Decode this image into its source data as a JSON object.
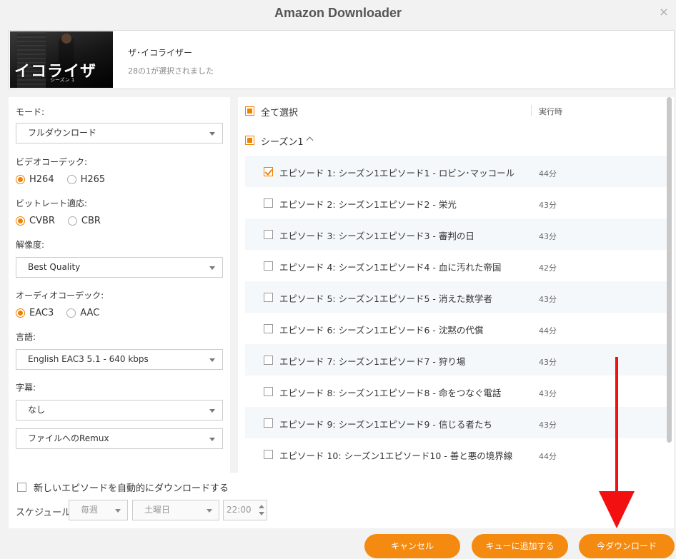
{
  "window": {
    "title": "Amazon Downloader",
    "close_glyph": "×"
  },
  "header": {
    "thumbnail_text": "イコライザ",
    "thumbnail_subtext": "シーズン 1",
    "show_name": "ザ･イコライザー",
    "selection_status": "28の1が選択されました"
  },
  "settings": {
    "mode_label": "モード:",
    "mode_value": "フルダウンロード",
    "video_codec_label": "ビデオコーデック:",
    "video_codec_options": [
      "H264",
      "H265"
    ],
    "video_codec_selected": "H264",
    "bitrate_label": "ビットレート適応:",
    "bitrate_options": [
      "CVBR",
      "CBR"
    ],
    "bitrate_selected": "CVBR",
    "resolution_label": "解像度:",
    "resolution_value": "Best Quality",
    "audio_codec_label": "オーディオコーデック:",
    "audio_codec_options": [
      "EAC3",
      "AAC"
    ],
    "audio_codec_selected": "EAC3",
    "language_label": "言語:",
    "language_value": "English EAC3 5.1 - 640 kbps",
    "subtitle_label": "字幕:",
    "subtitle_value": "なし",
    "remux_value": "ファイルへのRemux"
  },
  "episode_list": {
    "select_all_label": "全て選択",
    "runtime_header": "実行時",
    "season_label": "シーズン1",
    "episodes": [
      {
        "title": "エピソード 1: シーズン1エピソード1 - ロビン･マッコール",
        "runtime": "44分",
        "checked": true
      },
      {
        "title": "エピソード 2: シーズン1エピソード2 - 栄光",
        "runtime": "43分",
        "checked": false
      },
      {
        "title": "エピソード 3: シーズン1エピソード3 - 審判の日",
        "runtime": "43分",
        "checked": false
      },
      {
        "title": "エピソード 4: シーズン1エピソード4 - 血に汚れた帝国",
        "runtime": "42分",
        "checked": false
      },
      {
        "title": "エピソード 5: シーズン1エピソード5 - 消えた数学者",
        "runtime": "43分",
        "checked": false
      },
      {
        "title": "エピソード 6: シーズン1エピソード6 - 沈黙の代償",
        "runtime": "44分",
        "checked": false
      },
      {
        "title": "エピソード 7: シーズン1エピソード7 - 狩り場",
        "runtime": "43分",
        "checked": false
      },
      {
        "title": "エピソード 8: シーズン1エピソード8 - 命をつなぐ電話",
        "runtime": "43分",
        "checked": false
      },
      {
        "title": "エピソード 9: シーズン1エピソード9 - 信じる者たち",
        "runtime": "43分",
        "checked": false
      },
      {
        "title": "エピソード 10: シーズン1エピソード10 - 善と悪の境界線",
        "runtime": "44分",
        "checked": false
      }
    ]
  },
  "auto_download": {
    "label": "新しいエピソードを自動的にダウンロードする",
    "schedule_label": "スケジュール:",
    "frequency_value": "毎週",
    "day_value": "土曜日",
    "time_value": "22:00"
  },
  "buttons": {
    "cancel": "キャンセル",
    "add_to_queue": "キューに追加する",
    "download_now": "今ダウンロード"
  },
  "colors": {
    "accent": "#f58a10",
    "annotation_arrow": "#f21010"
  }
}
